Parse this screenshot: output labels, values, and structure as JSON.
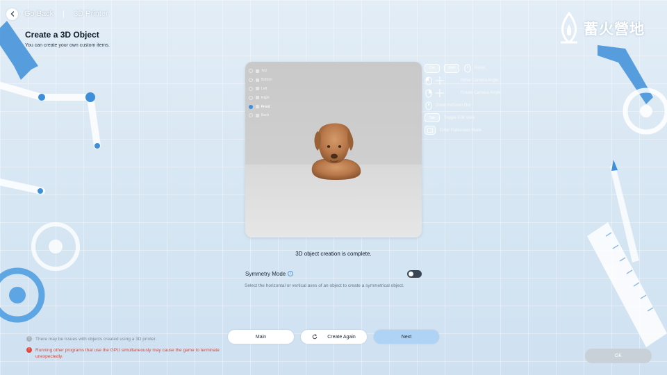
{
  "nav": {
    "back_label": "Go Back",
    "breadcrumb": "3D Printer"
  },
  "page": {
    "title": "Create a 3D Object",
    "subtitle": "You can create your own custom items."
  },
  "logo": {
    "text": "蓄火營地"
  },
  "viewport": {
    "views": [
      {
        "label": "Top",
        "selected": false
      },
      {
        "label": "Bottom",
        "selected": false
      },
      {
        "label": "Left",
        "selected": false
      },
      {
        "label": "Right",
        "selected": false
      },
      {
        "label": "Front",
        "selected": true
      },
      {
        "label": "Back",
        "selected": false
      }
    ]
  },
  "controls": {
    "ctrl_key": "Ctrl",
    "shift_key": "Shift",
    "reset_label": "Reset",
    "move_camera_label": "Move Camera Angle",
    "rotate_camera_label": "Rotate Camera Angle",
    "zoom_label": "Zoom In/Zoom Out",
    "tab_key": "Tab",
    "toggle_ui_label": "Toggle Edit View",
    "fullscreen_label": "Enter Fullscreen Mode"
  },
  "status_text": "3D object creation is complete.",
  "symmetry": {
    "label": "Symmetry Mode",
    "enabled": false,
    "description": "Select the horizontal or vertical axes of an object to create a symmetrical object."
  },
  "notes": {
    "info": "There may be issues with objects created using a 3D printer.",
    "warning": "Running other programs that use the GPU simultaneously may cause the game to terminate unexpectedly."
  },
  "buttons": {
    "main": "Main",
    "create_again": "Create Again",
    "next": "Next",
    "ok": "OK"
  },
  "colors": {
    "accent": "#aed3f5",
    "warning": "#e0453b",
    "toggle_off": "#3a4654"
  }
}
